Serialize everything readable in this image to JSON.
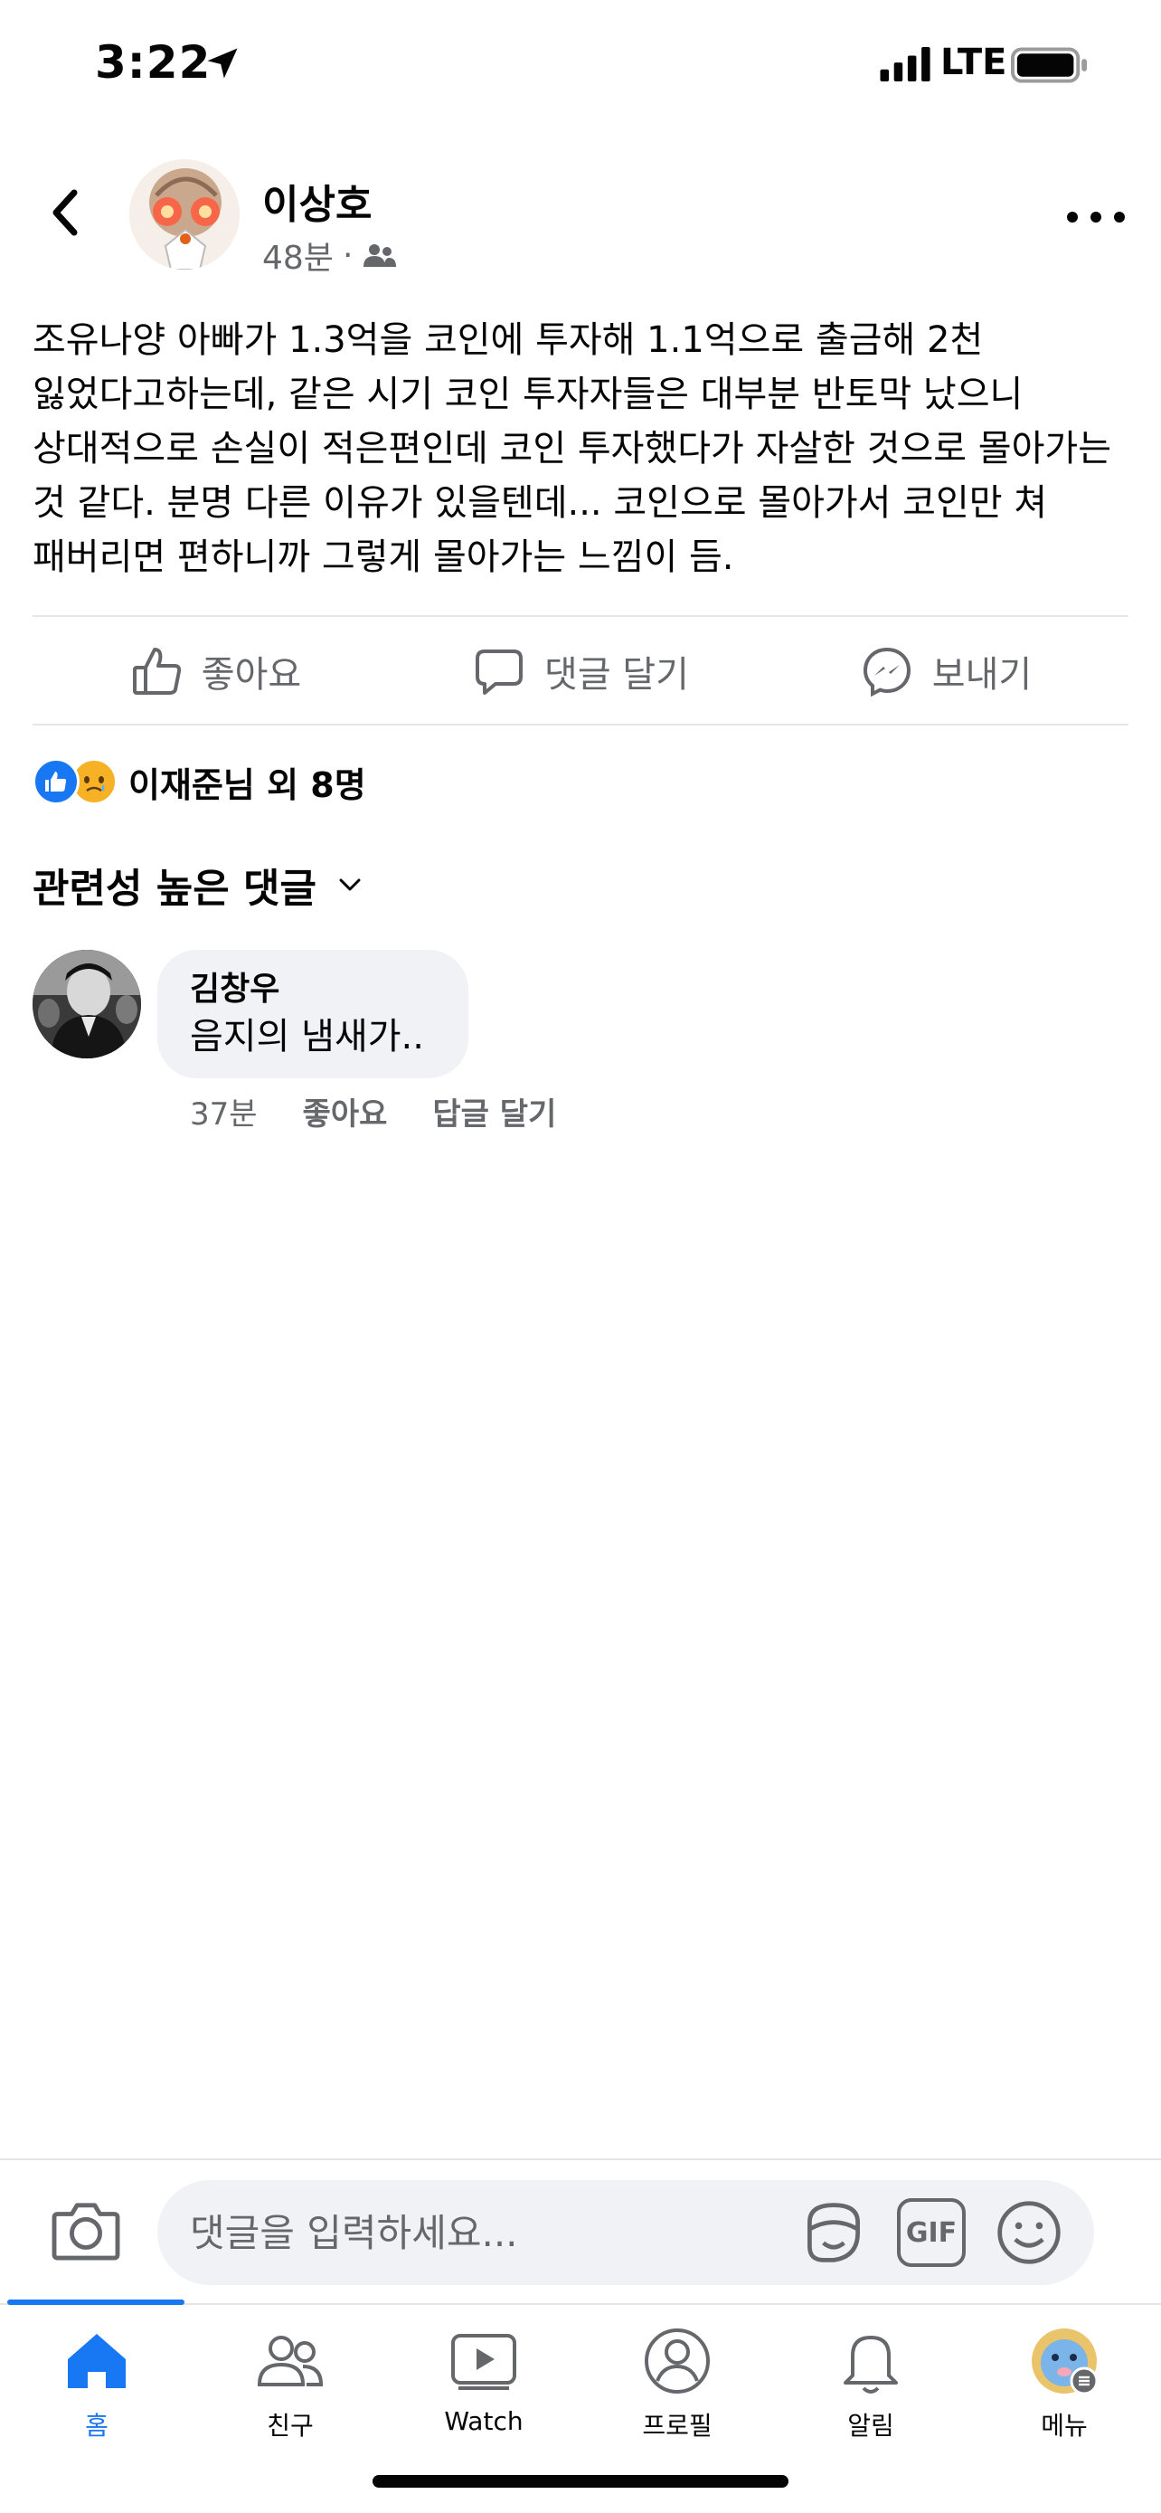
{
  "status_bar": {
    "time": "3:22",
    "network": "LTE"
  },
  "post": {
    "author": "이상호",
    "time": "48분",
    "separator": "·",
    "text": "조유나양 아빠가 1.3억을 코인에 투자해 1.1억으로 출금해 2천 잃었다고하는데, 같은 시기 코인 투자자들은 대부분 반토막 났으니 상대적으로 손실이 적은편인데 코인 투자했다가 자살한 것으로 몰아가는 것 같다. 분명 다른 이유가 있을텐데... 코인으로 몰아가서 코인만 쳐 패버리면 편하니까 그렇게 몰아가는 느낌이 듬."
  },
  "actions": {
    "like": "좋아요",
    "comment": "댓글 달기",
    "send": "보내기"
  },
  "reactions": {
    "summary": "이재준님 외 8명"
  },
  "comments_section": {
    "sort_label": "관련성 높은 댓글",
    "items": [
      {
        "author": "김창우",
        "text": "음지의 냄새가..",
        "time": "37분",
        "like": "좋아요",
        "reply": "답글 달기"
      }
    ]
  },
  "input": {
    "placeholder": "댓글을 입력하세요...",
    "gif_label": "GIF"
  },
  "tabs": [
    {
      "label": "홈",
      "icon": "home-icon",
      "active": true
    },
    {
      "label": "친구",
      "icon": "friends-icon"
    },
    {
      "label": "Watch",
      "icon": "watch-icon"
    },
    {
      "label": "프로필",
      "icon": "profile-icon"
    },
    {
      "label": "알림",
      "icon": "bell-icon"
    },
    {
      "label": "메뉴",
      "icon": "menu-avatar-icon"
    }
  ],
  "colors": {
    "accent": "#1877f2",
    "secondary_text": "#65676b",
    "bubble": "#f0f2f5"
  }
}
